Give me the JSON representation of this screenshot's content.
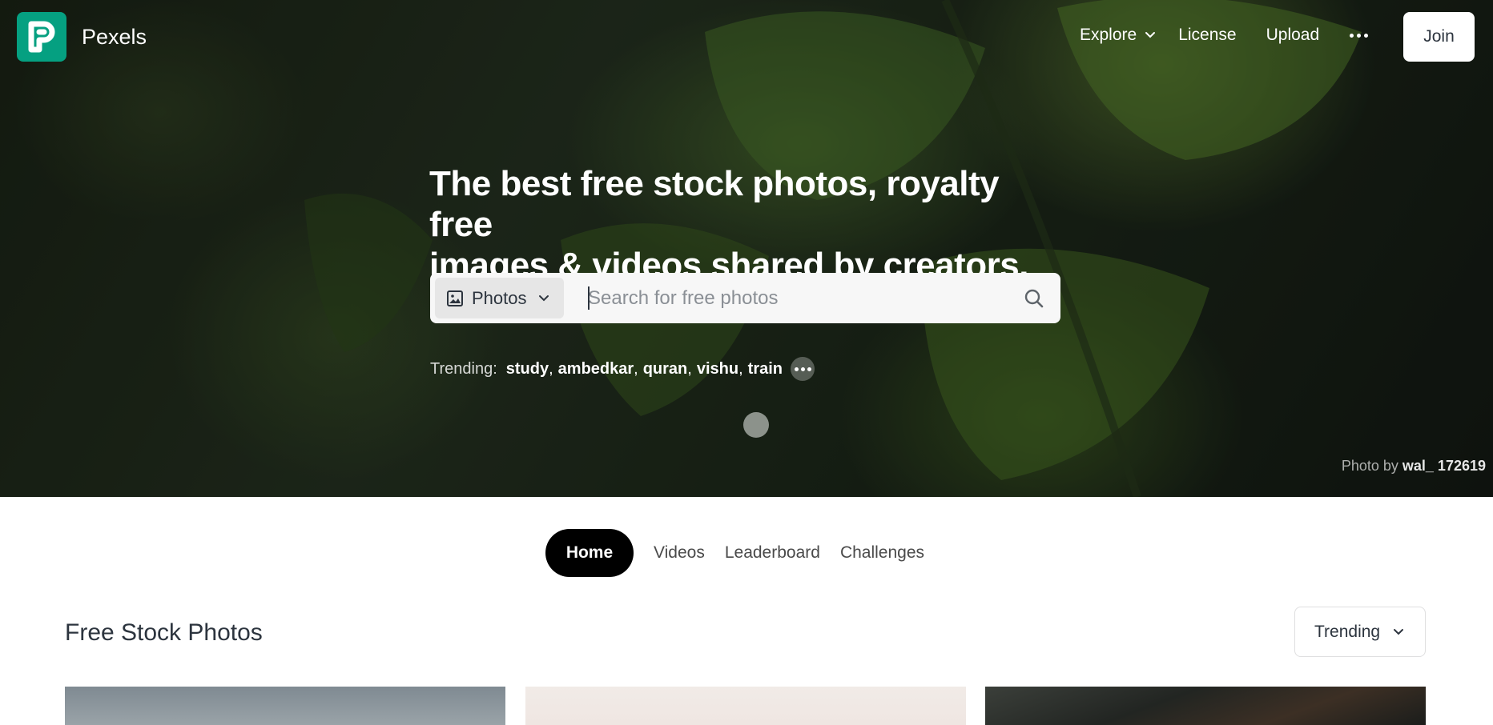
{
  "nav": {
    "brand": "Pexels",
    "explore": "Explore",
    "license": "License",
    "upload": "Upload",
    "join": "Join"
  },
  "hero": {
    "headline_line1": "The best free stock photos, royalty free",
    "headline_line2": "images & videos shared by creators.",
    "search": {
      "type_label": "Photos",
      "placeholder": "Search for free photos"
    },
    "trending": {
      "label": "Trending:",
      "items": [
        "study",
        "ambedkar",
        "quran",
        "vishu",
        "train"
      ]
    },
    "credit": {
      "prefix": "Photo by",
      "author": "wal_ 172619"
    }
  },
  "tabs": [
    {
      "label": "Home",
      "active": true
    },
    {
      "label": "Videos",
      "active": false
    },
    {
      "label": "Leaderboard",
      "active": false
    },
    {
      "label": "Challenges",
      "active": false
    }
  ],
  "section": {
    "title": "Free Stock Photos",
    "sort_label": "Trending"
  },
  "colors": {
    "brand": "#05a081",
    "tab_active_bg": "#000000",
    "text": "#2c343e"
  },
  "icons": {
    "logo": "pexels-logo-icon",
    "explore": "chevron-down-icon",
    "more": "more-dots-icon",
    "type_select": "image-icon",
    "search": "search-icon"
  }
}
